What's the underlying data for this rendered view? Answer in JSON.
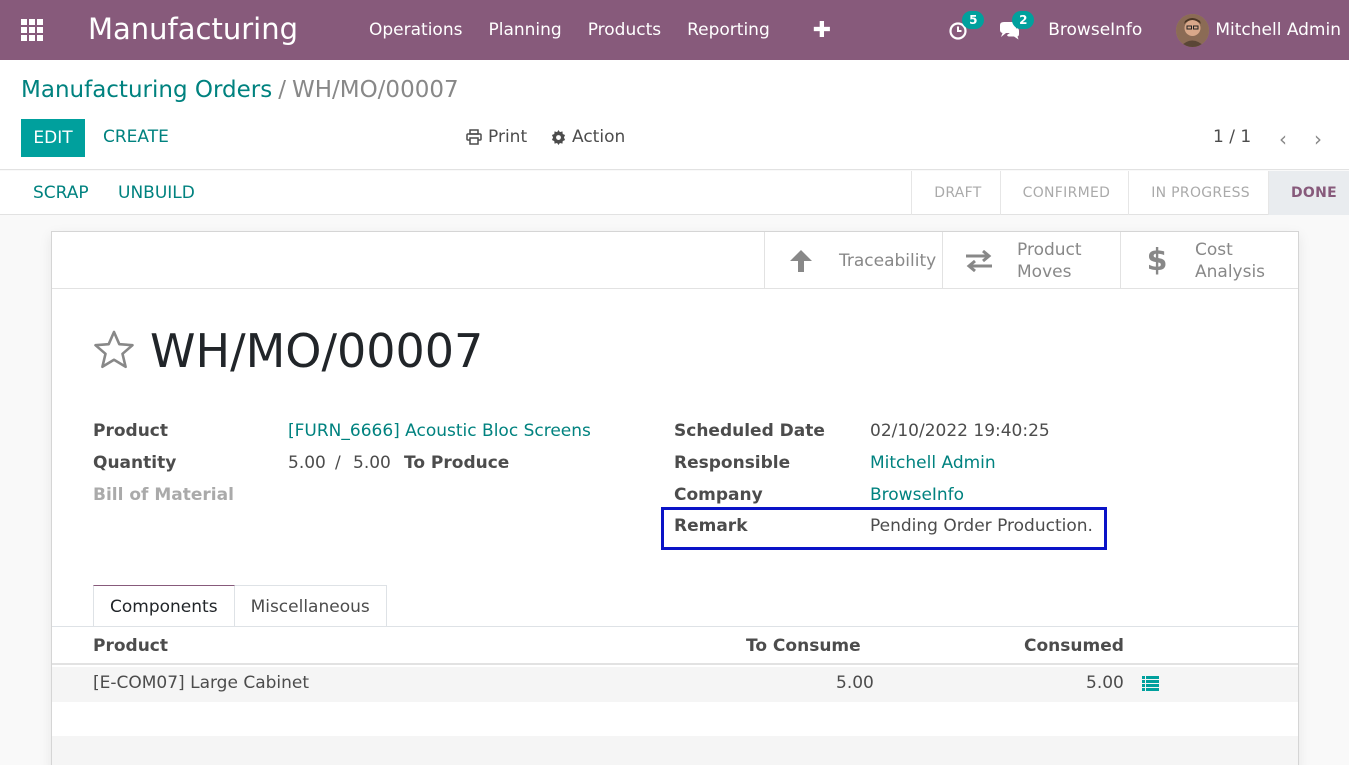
{
  "navbar": {
    "brand": "Manufacturing",
    "menu": [
      "Operations",
      "Planning",
      "Products",
      "Reporting"
    ],
    "plus": "✚",
    "activity_count": "5",
    "messages_count": "2",
    "company": "BrowseInfo",
    "user": "Mitchell Admin"
  },
  "breadcrumb": {
    "parent": "Manufacturing Orders",
    "separator": "/",
    "current": "WH/MO/00007"
  },
  "toolbar": {
    "edit_label": "EDIT",
    "create_label": "CREATE",
    "print_label": "Print",
    "action_label": "Action",
    "pager": "1 / 1"
  },
  "statusbar": {
    "scrap_label": "SCRAP",
    "unbuild_label": "UNBUILD",
    "stages": [
      "DRAFT",
      "CONFIRMED",
      "IN PROGRESS",
      "DONE"
    ],
    "active_stage": "DONE"
  },
  "smart_buttons": {
    "traceability": "Traceability",
    "product_moves_1": "Product",
    "product_moves_2": "Moves",
    "cost_analysis_1": "Cost",
    "cost_analysis_2": "Analysis"
  },
  "record": {
    "title": "WH/MO/00007",
    "labels": {
      "product": "Product",
      "quantity": "Quantity",
      "bom": "Bill of Material",
      "scheduled_date": "Scheduled Date",
      "responsible": "Responsible",
      "company": "Company",
      "remark": "Remark"
    },
    "product": "[FURN_6666] Acoustic Bloc Screens",
    "quantity_produced": "5.00",
    "quantity_sep": "/",
    "quantity_total": "5.00",
    "quantity_suffix": "To Produce",
    "scheduled_date": "02/10/2022 19:40:25",
    "responsible": "Mitchell Admin",
    "company": "BrowseInfo",
    "remark": "Pending Order Production."
  },
  "tabs": [
    "Components",
    "Miscellaneous"
  ],
  "components": {
    "headers": [
      "Product",
      "To Consume",
      "Consumed"
    ],
    "rows": [
      {
        "product": "[E-COM07] Large Cabinet",
        "to_consume": "5.00",
        "consumed": "5.00"
      }
    ]
  },
  "colors": {
    "navbar": "#875a7b",
    "primary": "#00a09d",
    "link": "#00827f",
    "highlight_box": "#0a13c7"
  }
}
